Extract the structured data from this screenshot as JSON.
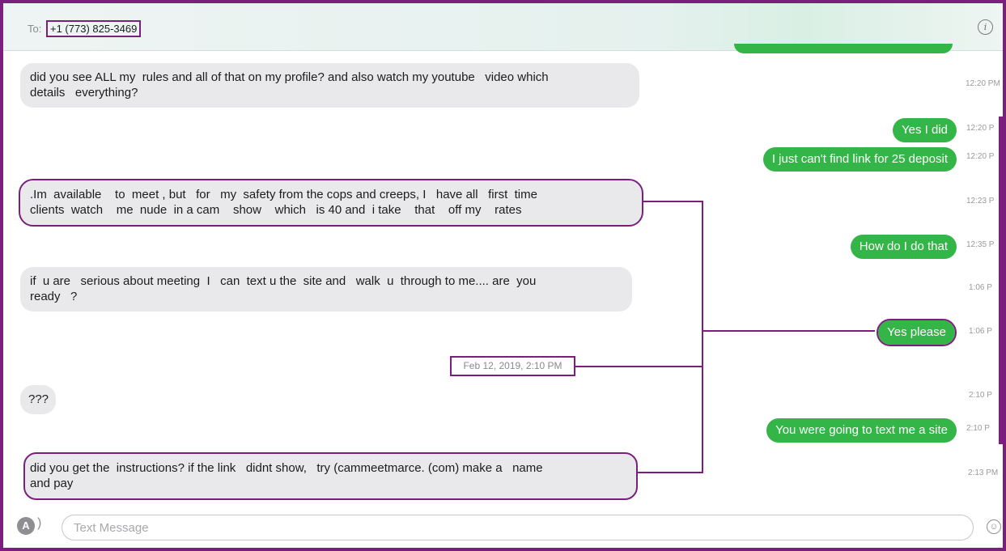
{
  "header": {
    "to_label": "To:",
    "recipient": "+1 (773) 825-3469",
    "info_icon": "info-icon"
  },
  "messages": [
    {
      "dir": "in",
      "text": "did you see ALL my  rules and all of that on my profile? and also watch my youtube   video which\ndetails   everything?",
      "time": "12:20 PM",
      "highlighted": false
    },
    {
      "dir": "out",
      "text": "Yes I did",
      "time": "12:20 P",
      "highlighted": false
    },
    {
      "dir": "out",
      "text": "I just can't find link for 25 deposit",
      "time": "12:20 P",
      "highlighted": false
    },
    {
      "dir": "in",
      "text": ".Im  available    to  meet , but   for   my  safety from the cops and creeps, I   have all   first  time\nclients  watch    me  nude  in a cam    show    which   is 40 and  i take    that    off my    rates",
      "time": "12:23 P",
      "highlighted": true
    },
    {
      "dir": "out",
      "text": "How do I do that",
      "time": "12:35 P",
      "highlighted": false
    },
    {
      "dir": "in",
      "text": "if  u are   serious about meeting  I   can  text u the  site and   walk  u  through to me.... are  you\nready   ?",
      "time": "1:06 P",
      "highlighted": false
    },
    {
      "dir": "out",
      "text": "Yes please",
      "time": "1:06 P",
      "highlighted": true
    },
    {
      "dir": "in",
      "text": "???",
      "time": "2:10 P",
      "highlighted": false
    },
    {
      "dir": "out",
      "text": "You were going to text me a site",
      "time": "2:10 P",
      "highlighted": false
    },
    {
      "dir": "in",
      "text": "did you get the  instructions? if the link   didnt show,   try (cammeetmarce. (com) make a   name\nand pay",
      "time": "2:13 PM",
      "highlighted": true
    }
  ],
  "date_separator": "Feb 12, 2019, 2:10 PM",
  "compose": {
    "placeholder": "Text Message",
    "apps_icon": "app-store-icon",
    "emoji_icon": "emoji-icon"
  },
  "colors": {
    "outgoing_bubble": "#34b548",
    "incoming_bubble": "#e9e9eb",
    "annotation": "#7a1f7d"
  }
}
